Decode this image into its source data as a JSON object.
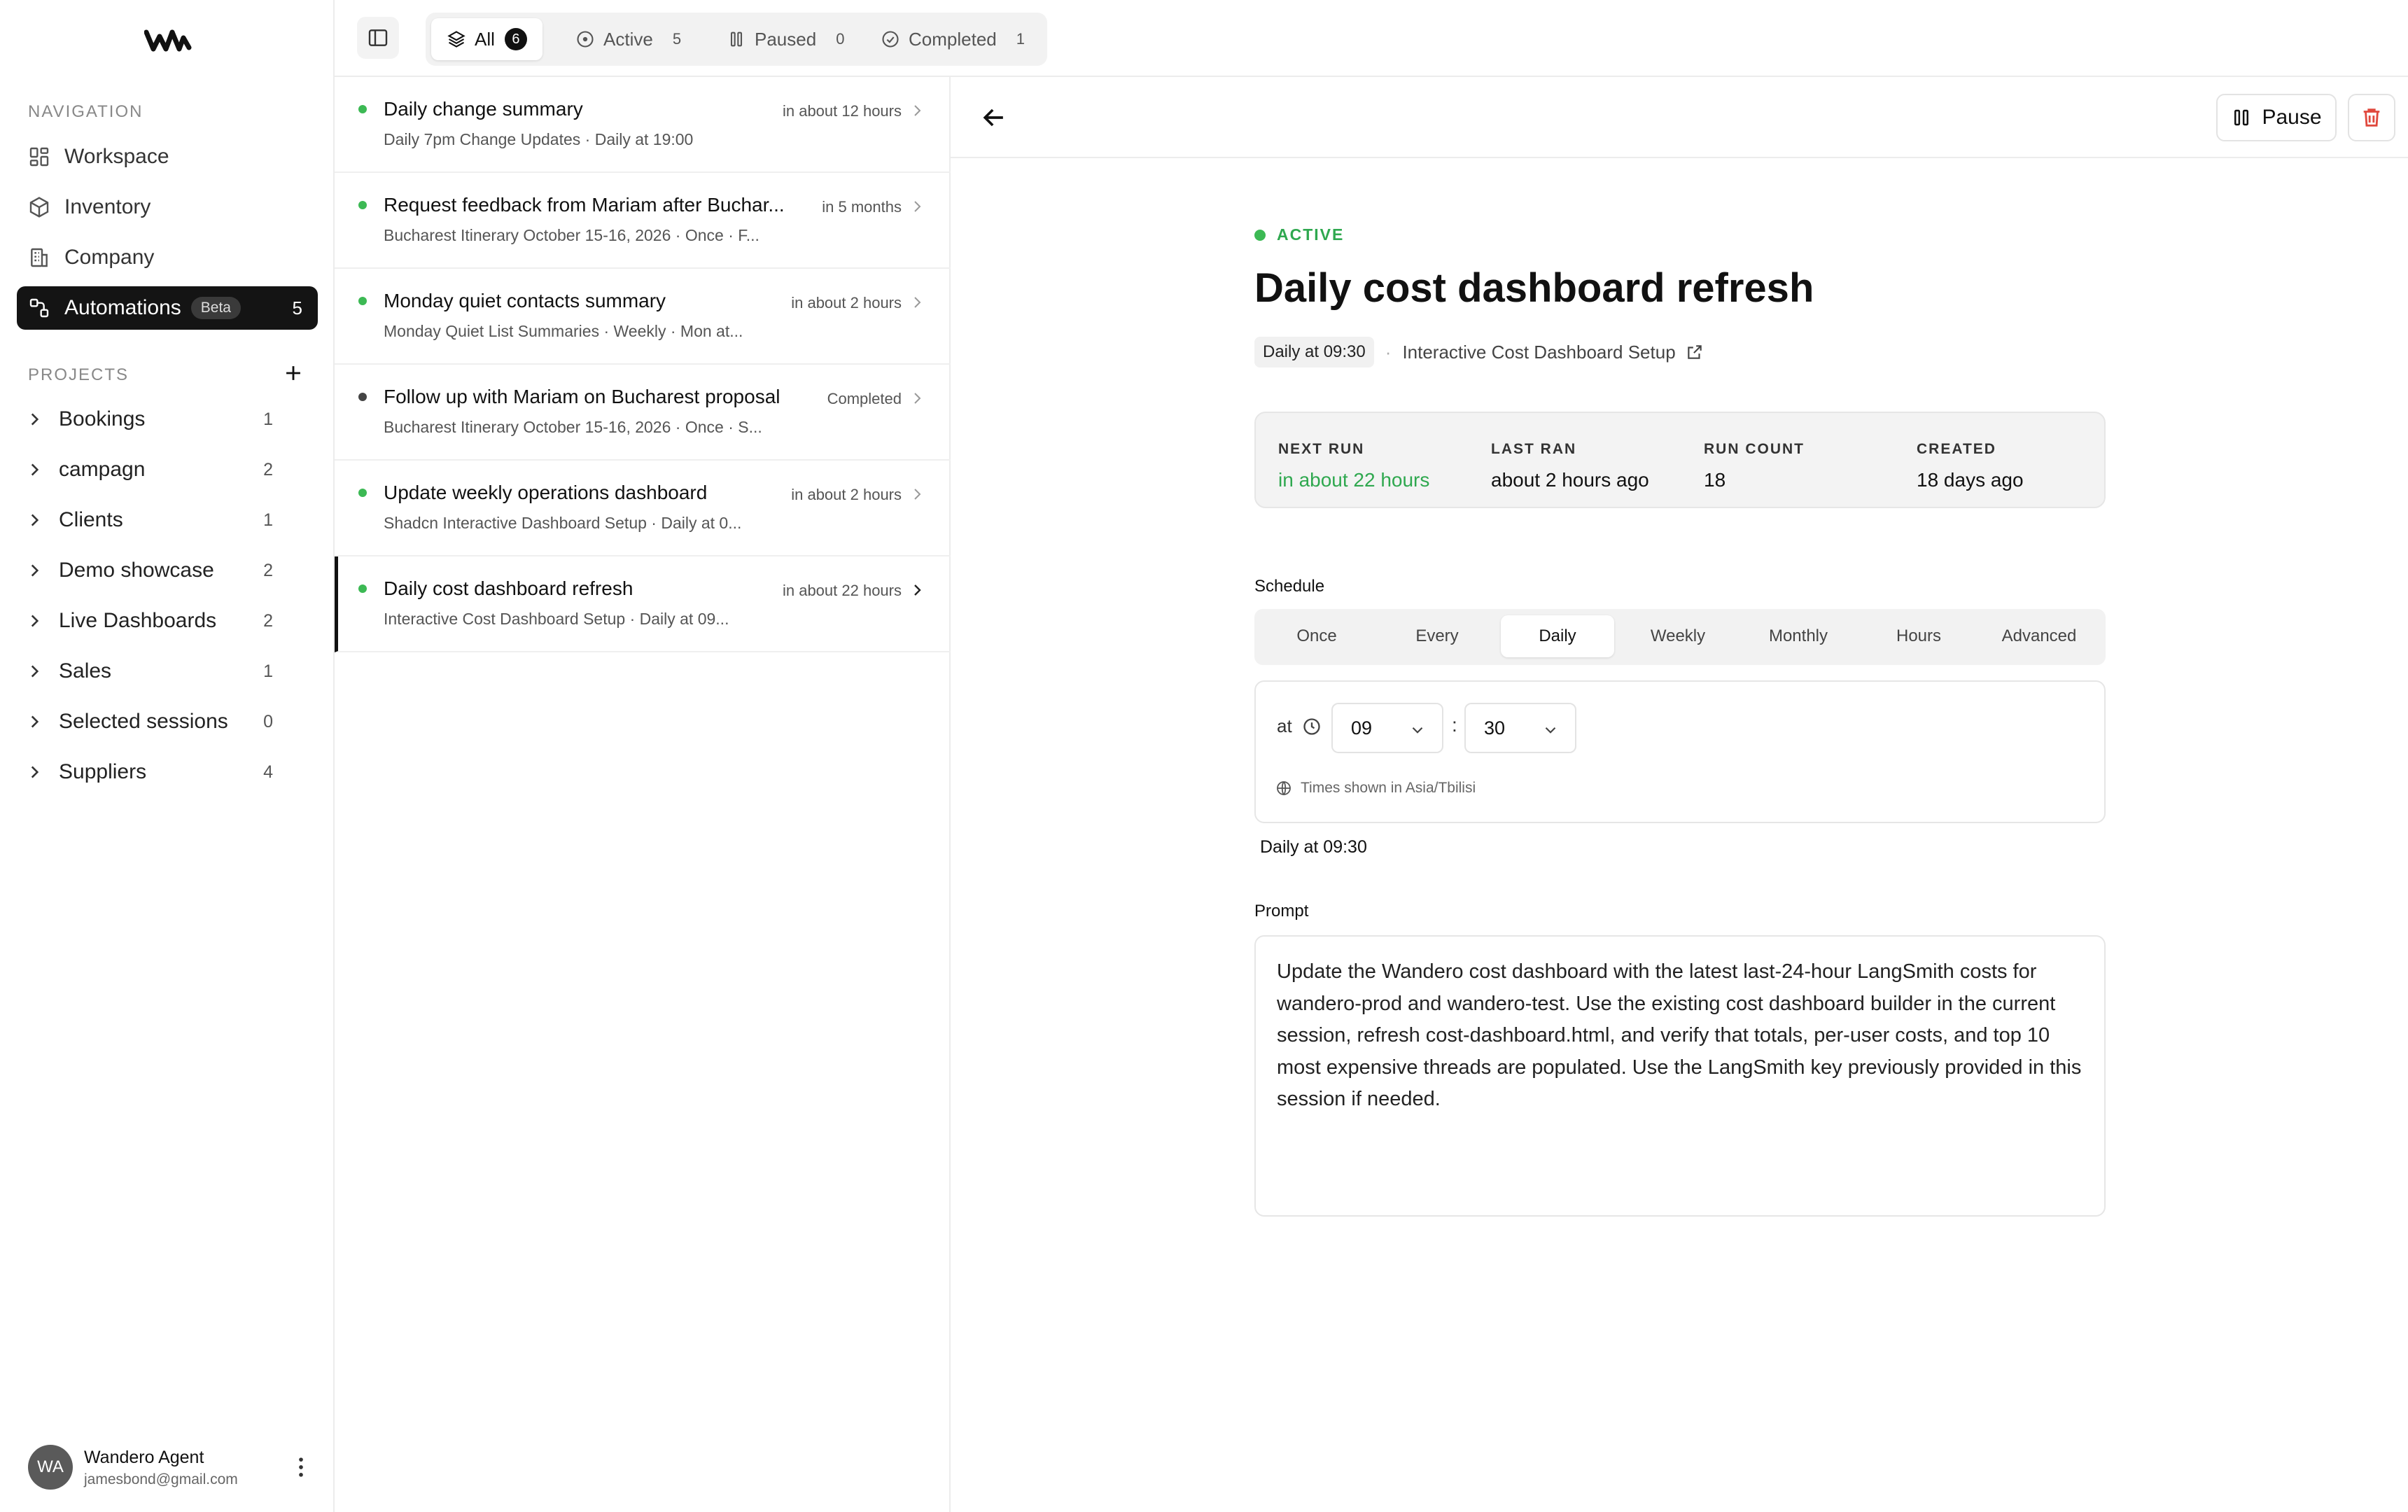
{
  "sidebar": {
    "logo_icon": "wandero-logo-icon",
    "nav_label": "NAVIGATION",
    "nav_items": [
      {
        "label": "Workspace",
        "icon": "grid-icon"
      },
      {
        "label": "Inventory",
        "icon": "box-icon"
      },
      {
        "label": "Company",
        "icon": "building-icon"
      },
      {
        "label": "Automations",
        "icon": "workflow-icon",
        "badge": "Beta",
        "count": "5"
      }
    ],
    "projects_label": "PROJECTS",
    "projects": [
      {
        "label": "Bookings",
        "count": "1"
      },
      {
        "label": "campagn",
        "count": "2"
      },
      {
        "label": "Clients",
        "count": "1"
      },
      {
        "label": "Demo showcase",
        "count": "2"
      },
      {
        "label": "Live Dashboards",
        "count": "2"
      },
      {
        "label": "Sales",
        "count": "1"
      },
      {
        "label": "Selected sessions",
        "count": "0"
      },
      {
        "label": "Suppliers",
        "count": "4"
      }
    ],
    "user": {
      "initials": "WA",
      "name": "Wandero Agent",
      "email": "jamesbond@gmail.com"
    }
  },
  "topbar": {
    "tabs": [
      {
        "label": "All",
        "count": "6",
        "icon": "layers-icon"
      },
      {
        "label": "Active",
        "count": "5",
        "icon": "play-circle-icon"
      },
      {
        "label": "Paused",
        "count": "0",
        "icon": "pause-icon"
      },
      {
        "label": "Completed",
        "count": "1",
        "icon": "check-circle-icon"
      }
    ]
  },
  "list": {
    "items": [
      {
        "title": "Daily change summary",
        "subtitle": "Daily 7pm Change Updates  ·  Daily at 19:00",
        "when": "in about 12 hours",
        "status": "active"
      },
      {
        "title": "Request feedback from Mariam after Buchar...",
        "subtitle": "Bucharest Itinerary October 15-16, 2026  ·  Once · F...",
        "when": "in 5 months",
        "status": "active"
      },
      {
        "title": "Monday quiet contacts summary",
        "subtitle": "Monday Quiet List Summaries  ·  Weekly · Mon at...",
        "when": "in about 2 hours",
        "status": "active"
      },
      {
        "title": "Follow up with Mariam on Bucharest proposal",
        "subtitle": "Bucharest Itinerary October 15-16, 2026  ·  Once · S...",
        "when": "Completed",
        "status": "completed"
      },
      {
        "title": "Update weekly operations dashboard",
        "subtitle": "Shadcn Interactive Dashboard Setup  ·  Daily at 0...",
        "when": "in about 2 hours",
        "status": "active"
      },
      {
        "title": "Daily cost dashboard refresh",
        "subtitle": "Interactive Cost Dashboard Setup  ·  Daily at 09...",
        "when": "in about 22 hours",
        "status": "active"
      }
    ]
  },
  "detail": {
    "pause_label": "Pause",
    "status": "ACTIVE",
    "title": "Daily cost dashboard refresh",
    "schedule_pill": "Daily at 09:30",
    "session_link": "Interactive Cost Dashboard Setup",
    "stats": [
      {
        "label": "NEXT RUN",
        "value": "in about 22 hours"
      },
      {
        "label": "LAST RAN",
        "value": "about 2 hours ago"
      },
      {
        "label": "RUN COUNT",
        "value": "18"
      },
      {
        "label": "CREATED",
        "value": "18 days ago"
      }
    ],
    "schedule_label": "Schedule",
    "schedule_tabs": [
      "Once",
      "Every",
      "Daily",
      "Weekly",
      "Monthly",
      "Hours",
      "Advanced"
    ],
    "schedule_selected": "Daily",
    "at_label": "at",
    "hour": "09",
    "minute": "30",
    "colon": ":",
    "timezone_note": "Times shown in Asia/Tbilisi",
    "schedule_summary": "Daily at 09:30",
    "prompt_label": "Prompt",
    "prompt": "Update the Wandero cost dashboard with the latest last-24-hour LangSmith costs for wandero-prod and wandero-test. Use the existing cost dashboard builder in the current session, refresh cost-dashboard.html, and verify that totals, per-user costs, and top 10 most expensive threads are populated. Use the LangSmith key previously provided in this session if needed."
  },
  "colors": {
    "accent_dark": "#141414",
    "active_green": "#3cb954",
    "delete_red": "#e0483d",
    "muted_text": "#555555"
  }
}
